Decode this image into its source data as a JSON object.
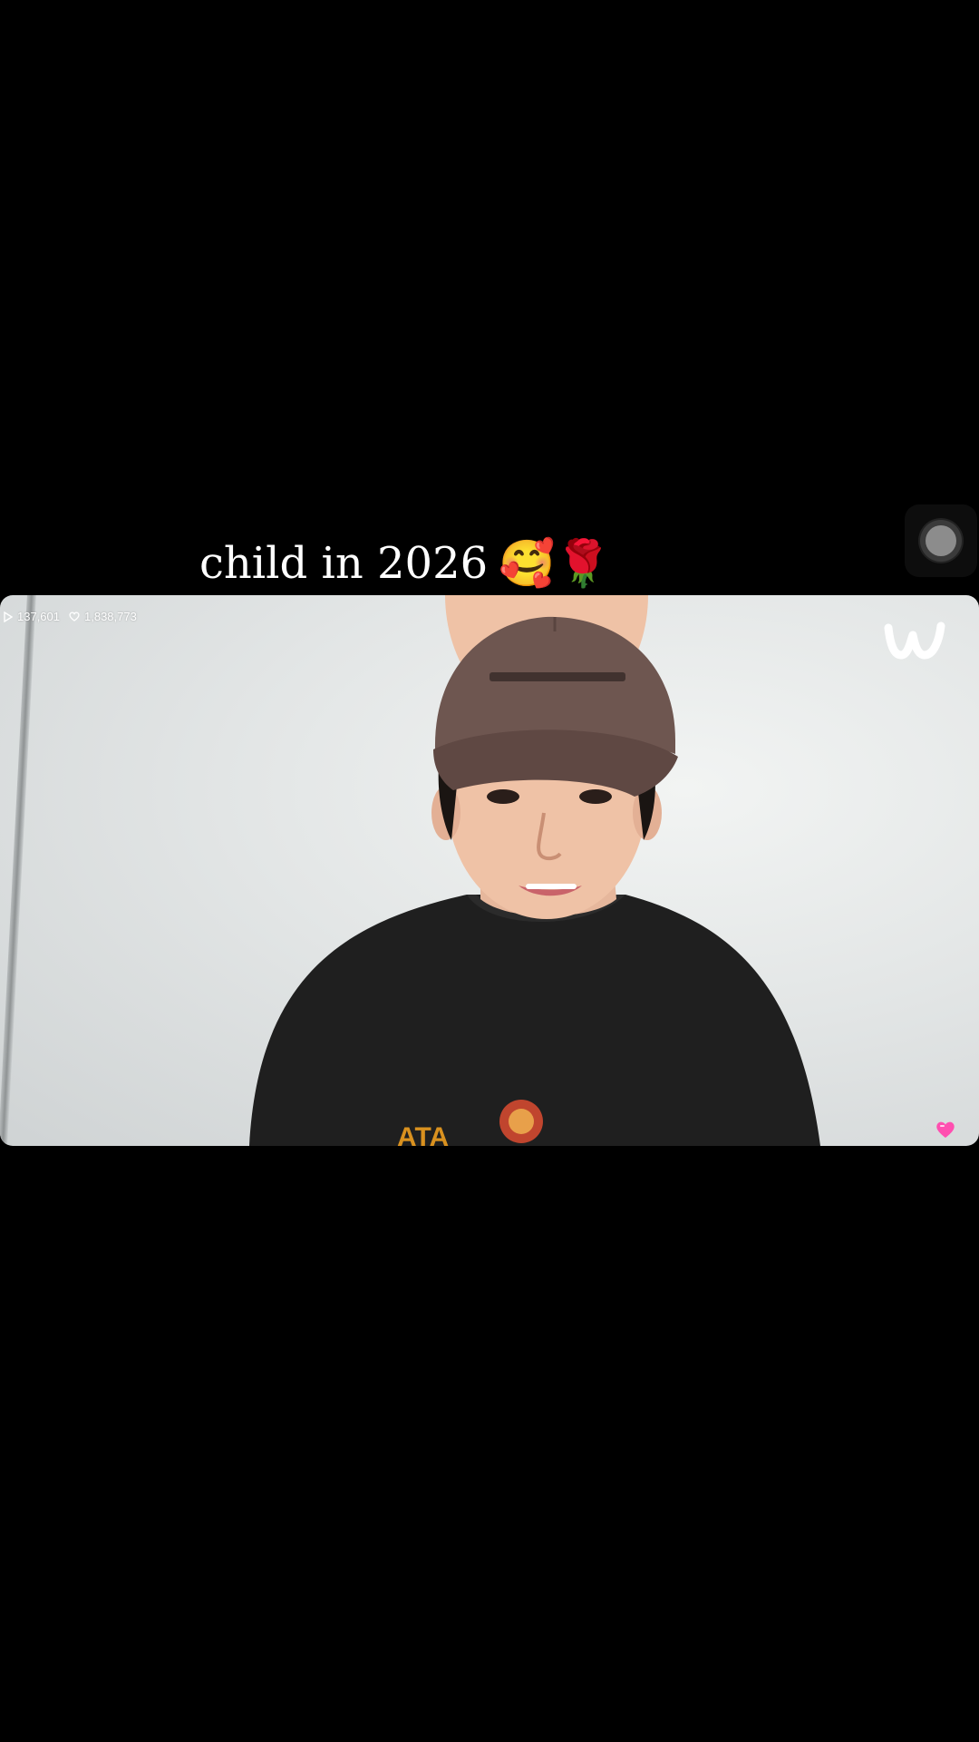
{
  "caption": {
    "text": "child in 2026",
    "emoji": "🥰🌹"
  },
  "video": {
    "stats": {
      "plays": "137,601",
      "likes": "1,838,773",
      "play_icon": "play-icon",
      "like_icon": "heart-outline-icon"
    },
    "brand_icon": "weverse-logo",
    "reaction_icon": "heart-badge-icon"
  },
  "floating_control": {
    "icon": "record-button-icon"
  },
  "colors": {
    "background": "#000000",
    "caption_text": "#ffffff",
    "reaction_heart": "#ff4fb0"
  }
}
